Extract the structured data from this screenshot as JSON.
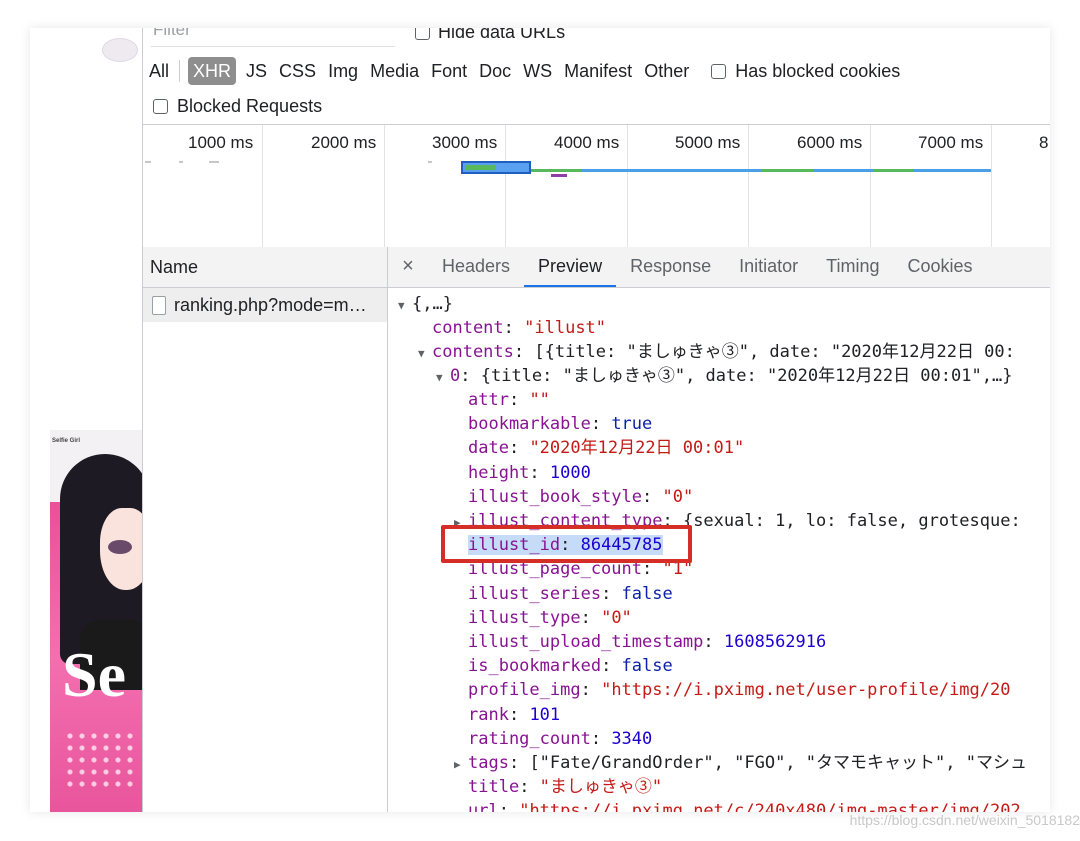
{
  "filter": {
    "placeholder": "Filter",
    "hide_data_urls": "Hide data URLs"
  },
  "resource_types": [
    "All",
    "XHR",
    "JS",
    "CSS",
    "Img",
    "Media",
    "Font",
    "Doc",
    "WS",
    "Manifest",
    "Other"
  ],
  "selected_type": "XHR",
  "has_blocked_cookies": "Has blocked cookies",
  "blocked_requests": "Blocked Requests",
  "timeline": {
    "ticks": [
      "1000 ms",
      "2000 ms",
      "3000 ms",
      "4000 ms",
      "5000 ms",
      "6000 ms",
      "7000 ms",
      "8"
    ]
  },
  "request_list": {
    "header": "Name",
    "rows": [
      "ranking.php?mode=m…"
    ]
  },
  "detail_tabs": [
    "Headers",
    "Preview",
    "Response",
    "Initiator",
    "Timing",
    "Cookies"
  ],
  "active_tab": "Preview",
  "artwork": {
    "cover_title": "Selfie Girl",
    "big_letters": "Se"
  },
  "preview": {
    "root": "{,…}",
    "content_key": "content",
    "content_val": "\"illust\"",
    "contents_key": "contents",
    "contents_summary": "[{title: \"ましゅきゃ③\", date: \"2020年12月22日 00:",
    "item0_key": "0",
    "item0_summary": "{title: \"ましゅきゃ③\", date: \"2020年12月22日 00:01\",…}",
    "fields": [
      {
        "key": "attr",
        "val": "\"\"",
        "kind": "s"
      },
      {
        "key": "bookmarkable",
        "val": "true",
        "kind": "b"
      },
      {
        "key": "date",
        "val": "\"2020年12月22日 00:01\"",
        "kind": "s"
      },
      {
        "key": "height",
        "val": "1000",
        "kind": "n"
      },
      {
        "key": "illust_book_style",
        "val": "\"0\"",
        "kind": "s"
      },
      {
        "key": "illust_content_type",
        "val": "{sexual: 1, lo: false, grotesque:",
        "kind": "p",
        "expandable": true
      },
      {
        "key": "illust_id",
        "val": "86445785",
        "kind": "n",
        "highlighted": true
      },
      {
        "key": "illust_page_count",
        "val": "\"1\"",
        "kind": "s"
      },
      {
        "key": "illust_series",
        "val": "false",
        "kind": "b"
      },
      {
        "key": "illust_type",
        "val": "\"0\"",
        "kind": "s"
      },
      {
        "key": "illust_upload_timestamp",
        "val": "1608562916",
        "kind": "n"
      },
      {
        "key": "is_bookmarked",
        "val": "false",
        "kind": "b"
      },
      {
        "key": "profile_img",
        "val": "\"https://i.pximg.net/user-profile/img/20",
        "kind": "s"
      },
      {
        "key": "rank",
        "val": "101",
        "kind": "n"
      },
      {
        "key": "rating_count",
        "val": "3340",
        "kind": "n"
      },
      {
        "key": "tags",
        "val": "[\"Fate/GrandOrder\", \"FGO\", \"タマモキャット\", \"マシュ",
        "kind": "p",
        "expandable": true
      },
      {
        "key": "title",
        "val": "\"ましゅきゃ③\"",
        "kind": "s"
      },
      {
        "key": "url",
        "val": "\"https://i.pximg.net/c/240x480/img-master/img/202",
        "kind": "s"
      }
    ]
  },
  "watermark": "https://blog.csdn.net/weixin_5018182",
  "colors": {
    "key": "#881391",
    "string": "#c41a16",
    "number": "#1c00cf",
    "highlight_box": "#d42e26",
    "active_tab": "#1a73e8"
  }
}
